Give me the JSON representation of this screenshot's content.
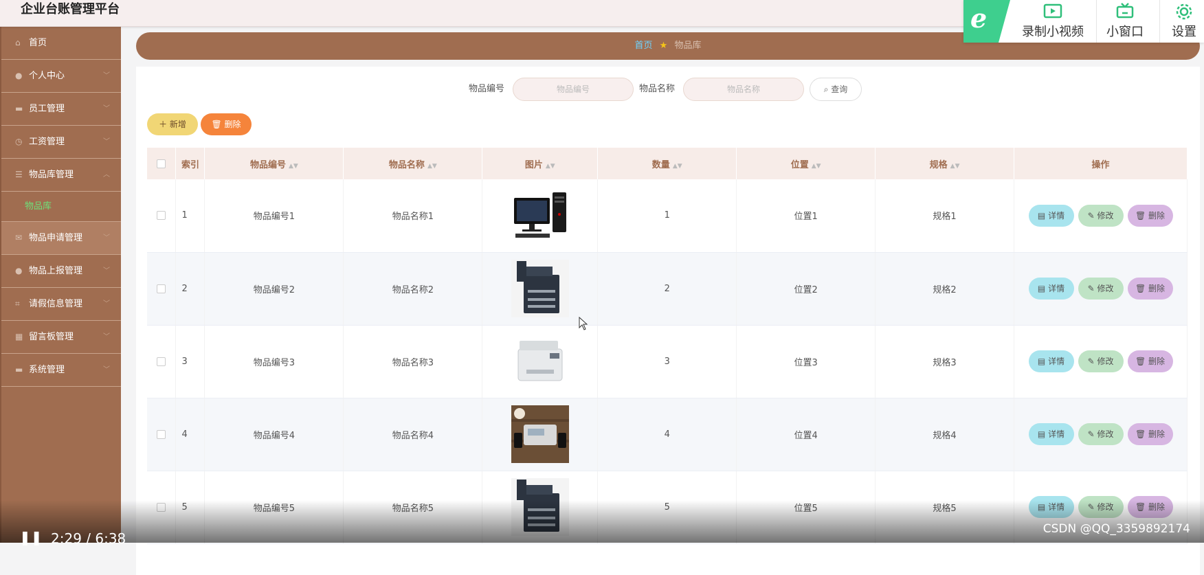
{
  "app": {
    "title": "企业台账管理平台"
  },
  "recorder": {
    "logo": "e",
    "record_label": "录制小视频",
    "pip_label": "小窗口",
    "settings_label": "设置"
  },
  "sidebar": {
    "items": [
      {
        "label": "首页",
        "icon": "home-icon"
      },
      {
        "label": "个人中心",
        "icon": "user-icon"
      },
      {
        "label": "员工管理",
        "icon": "list-icon"
      },
      {
        "label": "工资管理",
        "icon": "clock-icon"
      },
      {
        "label": "物品库管理",
        "icon": "menu-icon"
      },
      {
        "label": "物品申请管理",
        "icon": "ticket-icon"
      },
      {
        "label": "物品上报管理",
        "icon": "user-icon"
      },
      {
        "label": "请假信息管理",
        "icon": "crop-icon"
      },
      {
        "label": "留言板管理",
        "icon": "grid-icon"
      },
      {
        "label": "系统管理",
        "icon": "list-icon"
      }
    ],
    "sub_item": "物品库"
  },
  "breadcrumb": {
    "home": "首页",
    "current": "物品库"
  },
  "search": {
    "code_label": "物品编号",
    "code_placeholder": "物品编号",
    "name_label": "物品名称",
    "name_placeholder": "物品名称",
    "query_label": "查询"
  },
  "actions": {
    "add_label": "新增",
    "delete_label": "删除"
  },
  "table": {
    "headers": [
      "索引",
      "物品编号",
      "物品名称",
      "图片",
      "数量",
      "位置",
      "规格",
      "操作"
    ],
    "op_detail": "详情",
    "op_edit": "修改",
    "op_remove": "删除",
    "rows": [
      {
        "index": "1",
        "code": "物品编号1",
        "name": "物品名称1",
        "image": "computer",
        "qty": "1",
        "location": "位置1",
        "spec": "规格1"
      },
      {
        "index": "2",
        "code": "物品编号2",
        "name": "物品名称2",
        "image": "copier",
        "qty": "2",
        "location": "位置2",
        "spec": "规格2"
      },
      {
        "index": "3",
        "code": "物品编号3",
        "name": "物品名称3",
        "image": "printer",
        "qty": "3",
        "location": "位置3",
        "spec": "规格3"
      },
      {
        "index": "4",
        "code": "物品编号4",
        "name": "物品名称4",
        "image": "device",
        "qty": "4",
        "location": "位置4",
        "spec": "规格4"
      },
      {
        "index": "5",
        "code": "物品编号5",
        "name": "物品名称5",
        "image": "copier",
        "qty": "5",
        "location": "位置5",
        "spec": "规格5"
      }
    ]
  },
  "video": {
    "time": "2:29 / 6:38",
    "watermark": "CSDN @QQ_3359892174"
  }
}
